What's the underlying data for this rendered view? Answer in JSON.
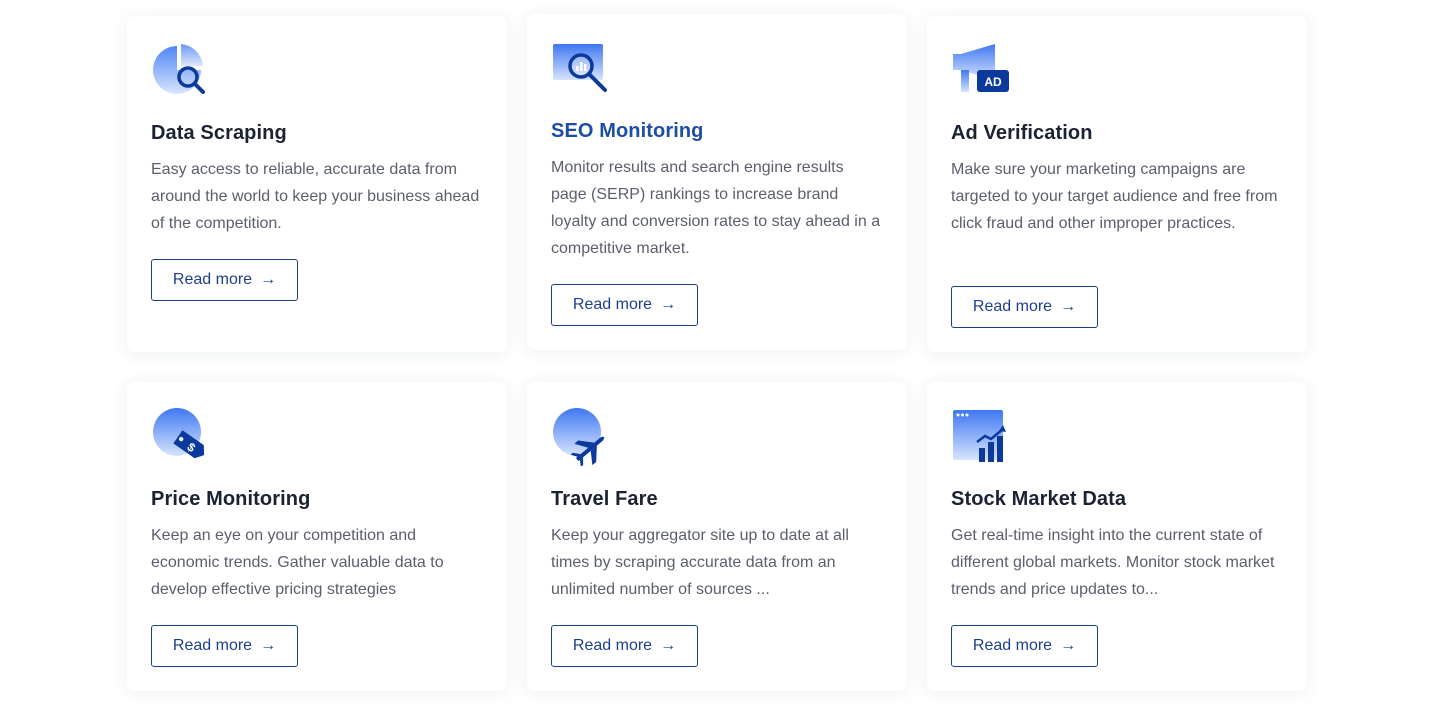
{
  "cards": [
    {
      "title": "Data Scraping",
      "description": "Easy access to reliable, accurate data from around the world to keep your business ahead of the competition.",
      "button_label": "Read more",
      "arrow": "→",
      "icon": "data-scraping-icon"
    },
    {
      "title": "SEO Monitoring",
      "description": "Monitor results and search engine results page (SERP) rankings to increase brand loyalty and conversion rates to stay ahead in a competitive market.",
      "button_label": "Read more",
      "arrow": "→",
      "icon": "seo-monitoring-icon"
    },
    {
      "title": "Ad Verification",
      "description": "Make sure your marketing campaigns are targeted to your target audience and free from click fraud and other improper practices.",
      "button_label": "Read more",
      "arrow": "→",
      "icon": "ad-verification-icon",
      "icon_badge": "AD"
    },
    {
      "title": "Price Monitoring",
      "description": "Keep an eye on your competition and economic trends. Gather valuable data to develop effective pricing strategies",
      "button_label": "Read more",
      "arrow": "→",
      "icon": "price-tag-icon",
      "icon_badge": "$"
    },
    {
      "title": "Travel Fare",
      "description": "Keep your aggregator site up to date at all times by scraping accurate data from an unlimited number of sources ...",
      "button_label": "Read more",
      "arrow": "→",
      "icon": "airplane-icon"
    },
    {
      "title": "Stock Market Data",
      "description": "Get real-time insight into the current state of different global markets. Monitor stock market trends and price updates to...",
      "button_label": "Read more",
      "arrow": "→",
      "icon": "stock-chart-icon"
    }
  ],
  "colors": {
    "accent": "#1e3f8c",
    "title": "#1b2233",
    "title_active": "#1d4ea3",
    "body_text": "#5a5f6b",
    "icon_light": "#5b8ef5",
    "icon_dark": "#0b3a9c"
  }
}
